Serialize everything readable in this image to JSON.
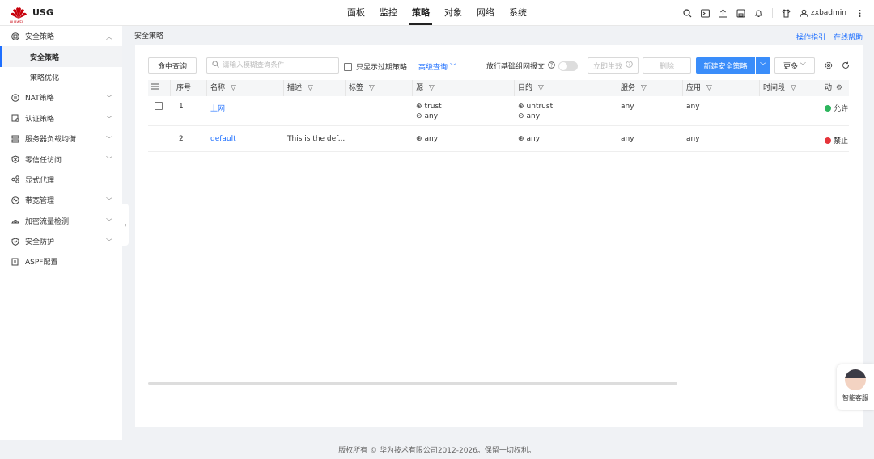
{
  "brand": {
    "name": "USG",
    "sub": "HUAWEI",
    "red": "#c7000b"
  },
  "nav": [
    "面板",
    "监控",
    "策略",
    "对象",
    "网络",
    "系统"
  ],
  "user": {
    "name": "zxbadmin"
  },
  "sidebar": {
    "items": [
      {
        "label": "安全策略",
        "icon": "security-policy-icon",
        "expanded": true
      },
      {
        "label": "安全策略",
        "sub": true,
        "selected": true
      },
      {
        "label": "策略优化",
        "sub": true
      },
      {
        "label": "NAT策略",
        "icon": "nat-icon"
      },
      {
        "label": "认证策略",
        "icon": "auth-icon"
      },
      {
        "label": "服务器负载均衡",
        "icon": "server-icon"
      },
      {
        "label": "零信任访问",
        "icon": "zero-trust-icon"
      },
      {
        "label": "显式代理",
        "icon": "proxy-icon"
      },
      {
        "label": "带宽管理",
        "icon": "bandwidth-icon"
      },
      {
        "label": "加密流量检测",
        "icon": "encrypt-icon"
      },
      {
        "label": "安全防护",
        "icon": "shield-icon"
      },
      {
        "label": "ASPF配置",
        "icon": "aspf-icon"
      }
    ]
  },
  "page": {
    "breadcrumb": "安全策略",
    "guide": "操作指引",
    "help": "在线帮助"
  },
  "toolbar": {
    "hit_query": "命中查询",
    "search_placeholder": "请输入模糊查询条件",
    "only_expired": "只显示过期策略",
    "advanced_query": "高级查询",
    "allow_basic": "放行基础组网报文",
    "apply_now": "立即生效",
    "delete": "删除",
    "new_policy": "新建安全策略",
    "more": "更多"
  },
  "table": {
    "headers": [
      "序号",
      "名称",
      "描述",
      "标签",
      "源",
      "目的",
      "服务",
      "应用",
      "时间段",
      "动"
    ],
    "rows": [
      {
        "seq": "1",
        "name": "上网",
        "desc": "",
        "tag": "",
        "src": [
          "trust",
          "any"
        ],
        "dst": [
          "untrust",
          "any"
        ],
        "service": "any",
        "app": "any",
        "time": "",
        "action": "允许",
        "action_color": "#2db55d"
      },
      {
        "seq": "2",
        "name": "default",
        "desc": "This is the def...",
        "tag": "",
        "src": [
          "any"
        ],
        "dst": [
          "any"
        ],
        "service": "any",
        "app": "any",
        "time": "",
        "action": "禁止",
        "action_color": "#e5343a"
      }
    ]
  },
  "footer": "版权所有 © 华为技术有限公司2012-2026。保留一切权利。",
  "assistant": "智能客服",
  "colors": {
    "accent": "#1e6fff",
    "primary_btn": "#3a8dfa"
  }
}
